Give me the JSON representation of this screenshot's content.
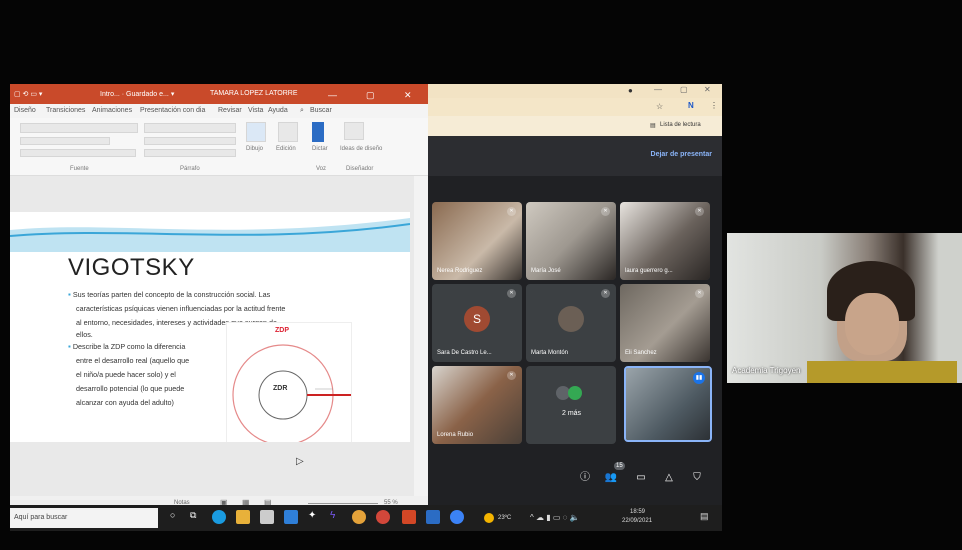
{
  "ppt": {
    "title_items": [
      "Intro... · Guardado e... ▾",
      "TAMARA LOPEZ LATORRE"
    ],
    "menu": [
      "Diseño",
      "Transiciones",
      "Animaciones",
      "Presentación con dia",
      "Revisar",
      "Vista",
      "Ayuda",
      "Buscar"
    ],
    "ribbon_groups": [
      "Fuente",
      "Párrafo",
      "Voz",
      "Diseñador"
    ],
    "ribbon_buttons": [
      "Dibujo",
      "Edición",
      "Dictar",
      "Ideas de diseño"
    ],
    "slide": {
      "title": "VIGOTSKY",
      "bullet1_lines": [
        "Sus teorías parten del concepto de la construcción social. Las",
        "características psíquicas  vienen influenciadas por la actitud frente",
        "al entorno, necesidades, intereses y actividades que surgen de",
        "ellos."
      ],
      "bullet2_lines": [
        "Describe la ZDP como la diferencia",
        "entre el desarrollo real (aquello que",
        "el niño/a puede hacer solo) y el",
        "desarrollo potencial (lo que puede",
        "alcanzar con ayuda del adulto)"
      ],
      "zdp_label": "ZDP",
      "zdr_label": "ZDR"
    },
    "status": {
      "notes": "Notas",
      "zoom": "55 %"
    }
  },
  "meet": {
    "bookmarks": "Lista de lectura",
    "stop_presenting": "Dejar de presentar",
    "participants": [
      {
        "name": "Nerea Rodriguez",
        "type": "video",
        "bg": "#8a6a50"
      },
      {
        "name": "María José",
        "type": "video",
        "bg": "#b9b3a9"
      },
      {
        "name": "laura guerrero g...",
        "type": "video",
        "bg": "#4a4440"
      },
      {
        "name": "Sara De Castro Le...",
        "type": "avatar",
        "initial": "S",
        "bg": "#a04a32"
      },
      {
        "name": "Marta Montón",
        "type": "avatar",
        "initial": "",
        "bg": "#6b5f55"
      },
      {
        "name": "Eli Sanchez",
        "type": "video",
        "bg": "#7e7870"
      },
      {
        "name": "Lorena Rubio",
        "type": "video",
        "bg": "#6f6a64"
      },
      {
        "name": "2 más",
        "type": "more",
        "bg": "#3c4043"
      },
      {
        "name": "",
        "type": "self",
        "bg": "#5f6b73"
      }
    ],
    "participant_count": "15"
  },
  "taskbar": {
    "search": "Aquí para buscar",
    "weather": "23ºC",
    "time": "18:59",
    "date": "22/09/2021"
  },
  "right_video": {
    "name": "Academia Trigoyen"
  },
  "colors": {
    "ppt_accent": "#c94a2a",
    "meet_bg": "#202124",
    "meet_link": "#8ab4f8",
    "slide_accent": "#3aa6d8"
  }
}
